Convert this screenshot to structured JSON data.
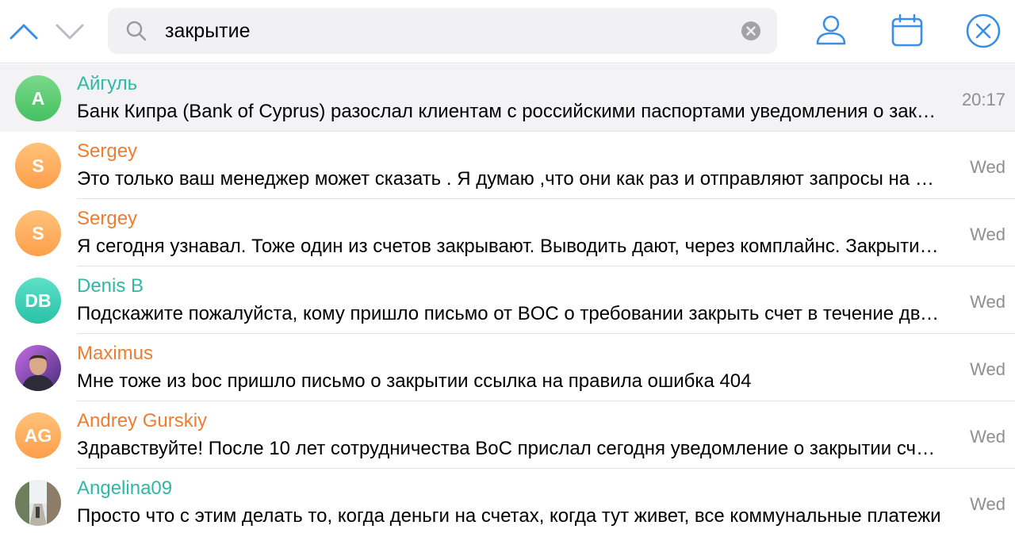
{
  "search": {
    "query": "закрытие"
  },
  "results": [
    {
      "name": "Айгуль",
      "initials": "А",
      "message": "Банк Кипра (Bank of Cyprus) разослал клиентам с российскими паспортами уведомления о закрытии счетов",
      "time": "20:17",
      "name_color": "#2fb8a4",
      "avatar_gradient": [
        "#7ad98a",
        "#45c062"
      ],
      "selected": true
    },
    {
      "name": "Sergey",
      "initials": "S",
      "message": "Это только ваш менеджер может сказать . Я думаю ,что они как раз и отправляют запросы на закрытие",
      "time": "Wed",
      "name_color": "#ee7d2f",
      "avatar_gradient": [
        "#ffc27a",
        "#ff9f4a"
      ],
      "selected": false
    },
    {
      "name": "Sergey",
      "initials": "S",
      "message": "Я сегодня узнавал. Тоже один из счетов закрывают. Выводить дают, через комплайнс. Закрытие счета",
      "time": "Wed",
      "name_color": "#ee7d2f",
      "avatar_gradient": [
        "#ffc27a",
        "#ff9f4a"
      ],
      "selected": false
    },
    {
      "name": "Denis B",
      "initials": "DB",
      "message": "Подскажите пожалуйста, кому пришло письмо от BOC о требовании закрыть счет в течение двух месяцев",
      "time": "Wed",
      "name_color": "#2fb8a4",
      "avatar_gradient": [
        "#5ee0c6",
        "#28c2a8"
      ],
      "selected": false
    },
    {
      "name": "Maximus",
      "initials": "",
      "message": "Мне тоже из boc пришло письмо о закрытии ссылка на правила ошибка 404",
      "time": "Wed",
      "name_color": "#ee7d2f",
      "avatar_gradient": [
        "#a46ad6",
        "#6b3fa0"
      ],
      "selected": false
    },
    {
      "name": "Andrey Gurskiy",
      "initials": "AG",
      "message": "Здравствуйте! После 10 лет сотрудничества BoC прислал сегодня уведомление о закрытии счета",
      "time": "Wed",
      "name_color": "#ee7d2f",
      "avatar_gradient": [
        "#ffc27a",
        "#ff9f4a"
      ],
      "selected": false
    },
    {
      "name": "Angelina09",
      "initials": "",
      "message": "Просто что с этим делать то, когда деньги на счетах, когда тут живет, все коммунальные платежи",
      "time": "Wed",
      "name_color": "#2fb8a4",
      "avatar_gradient": [
        "#c9d6c1",
        "#7d8f74"
      ],
      "selected": false
    }
  ],
  "icons": {
    "nav_up": "chevron-up-icon",
    "nav_down": "chevron-down-icon",
    "search": "search-icon",
    "clear": "clear-icon",
    "user": "user-icon",
    "calendar": "calendar-icon",
    "close": "close-icon"
  },
  "colors": {
    "accent": "#3a8ee6",
    "muted": "#8e8e93",
    "search_bg": "#f1f1f4"
  }
}
